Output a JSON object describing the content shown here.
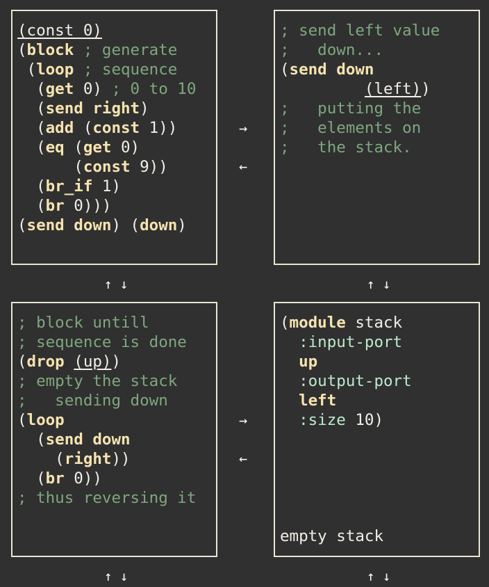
{
  "panels": {
    "top_left": {
      "lines": [
        [
          {
            "t": "(const 0)",
            "c": "u"
          }
        ],
        [
          {
            "t": "("
          },
          {
            "t": "block",
            "c": "kw"
          },
          {
            "t": " "
          },
          {
            "t": "; generate",
            "c": "cm"
          }
        ],
        [
          {
            "t": " ("
          },
          {
            "t": "loop",
            "c": "kw"
          },
          {
            "t": " "
          },
          {
            "t": "; sequence",
            "c": "cm"
          }
        ],
        [
          {
            "t": "  ("
          },
          {
            "t": "get",
            "c": "kw"
          },
          {
            "t": " 0) "
          },
          {
            "t": "; 0 to 10",
            "c": "cm"
          }
        ],
        [
          {
            "t": "  ("
          },
          {
            "t": "send",
            "c": "kw"
          },
          {
            "t": " "
          },
          {
            "t": "right",
            "c": "kw"
          },
          {
            "t": ")"
          }
        ],
        [
          {
            "t": "  ("
          },
          {
            "t": "add",
            "c": "kw"
          },
          {
            "t": " ("
          },
          {
            "t": "const",
            "c": "kw"
          },
          {
            "t": " 1))"
          }
        ],
        [
          {
            "t": "  ("
          },
          {
            "t": "eq",
            "c": "kw"
          },
          {
            "t": " ("
          },
          {
            "t": "get",
            "c": "kw"
          },
          {
            "t": " 0)"
          }
        ],
        [
          {
            "t": "      ("
          },
          {
            "t": "const",
            "c": "kw"
          },
          {
            "t": " 9))"
          }
        ],
        [
          {
            "t": "  ("
          },
          {
            "t": "br_if",
            "c": "kw"
          },
          {
            "t": " 1)"
          }
        ],
        [
          {
            "t": "  ("
          },
          {
            "t": "br",
            "c": "kw"
          },
          {
            "t": " 0)))"
          }
        ],
        [
          {
            "t": "("
          },
          {
            "t": "send",
            "c": "kw"
          },
          {
            "t": " "
          },
          {
            "t": "down",
            "c": "kw"
          },
          {
            "t": ") ("
          },
          {
            "t": "down",
            "c": "kw"
          },
          {
            "t": ")"
          }
        ]
      ],
      "status": ""
    },
    "top_right": {
      "lines": [
        [
          {
            "t": "; send left value",
            "c": "cm"
          }
        ],
        [
          {
            "t": ";   down...",
            "c": "cm"
          }
        ],
        [
          {
            "t": "("
          },
          {
            "t": "send",
            "c": "kw"
          },
          {
            "t": " "
          },
          {
            "t": "down",
            "c": "kw"
          }
        ],
        [
          {
            "t": "         "
          },
          {
            "t": "(left)",
            "c": "u"
          },
          {
            "t": ")"
          }
        ],
        [
          {
            "t": ";   putting the",
            "c": "cm"
          }
        ],
        [
          {
            "t": ";   elements on",
            "c": "cm"
          }
        ],
        [
          {
            "t": ";   the stack.",
            "c": "cm"
          }
        ]
      ],
      "status": ""
    },
    "bottom_left": {
      "lines": [
        [
          {
            "t": "; block untill",
            "c": "cm"
          }
        ],
        [
          {
            "t": "; sequence is done",
            "c": "cm"
          }
        ],
        [
          {
            "t": "("
          },
          {
            "t": "drop",
            "c": "kw"
          },
          {
            "t": " "
          },
          {
            "t": "(up)",
            "c": "u"
          },
          {
            "t": ")"
          }
        ],
        [
          {
            "t": "; empty the stack",
            "c": "cm"
          }
        ],
        [
          {
            "t": ";   sending down",
            "c": "cm"
          }
        ],
        [
          {
            "t": "("
          },
          {
            "t": "loop",
            "c": "kw"
          }
        ],
        [
          {
            "t": "  ("
          },
          {
            "t": "send",
            "c": "kw"
          },
          {
            "t": " "
          },
          {
            "t": "down",
            "c": "kw"
          }
        ],
        [
          {
            "t": "    ("
          },
          {
            "t": "right",
            "c": "kw"
          },
          {
            "t": "))"
          }
        ],
        [
          {
            "t": "  ("
          },
          {
            "t": "br",
            "c": "kw"
          },
          {
            "t": " 0))"
          }
        ],
        [
          {
            "t": "; thus reversing it",
            "c": "cm"
          }
        ]
      ],
      "status": ""
    },
    "bottom_right": {
      "lines": [
        [
          {
            "t": "("
          },
          {
            "t": "module",
            "c": "kw"
          },
          {
            "t": " stack"
          }
        ],
        [
          {
            "t": "  "
          },
          {
            "t": ":input-port",
            "c": "sym"
          }
        ],
        [
          {
            "t": "  "
          },
          {
            "t": "up",
            "c": "kw"
          }
        ],
        [
          {
            "t": "  "
          },
          {
            "t": ":output-port",
            "c": "sym"
          }
        ],
        [
          {
            "t": "  "
          },
          {
            "t": "left",
            "c": "kw"
          }
        ],
        [
          {
            "t": "  "
          },
          {
            "t": ":size",
            "c": "sym"
          },
          {
            "t": " 10)"
          }
        ]
      ],
      "status": "empty stack"
    }
  },
  "arrows": {
    "right": "→",
    "left": "←",
    "updown": "↑ ↓"
  }
}
